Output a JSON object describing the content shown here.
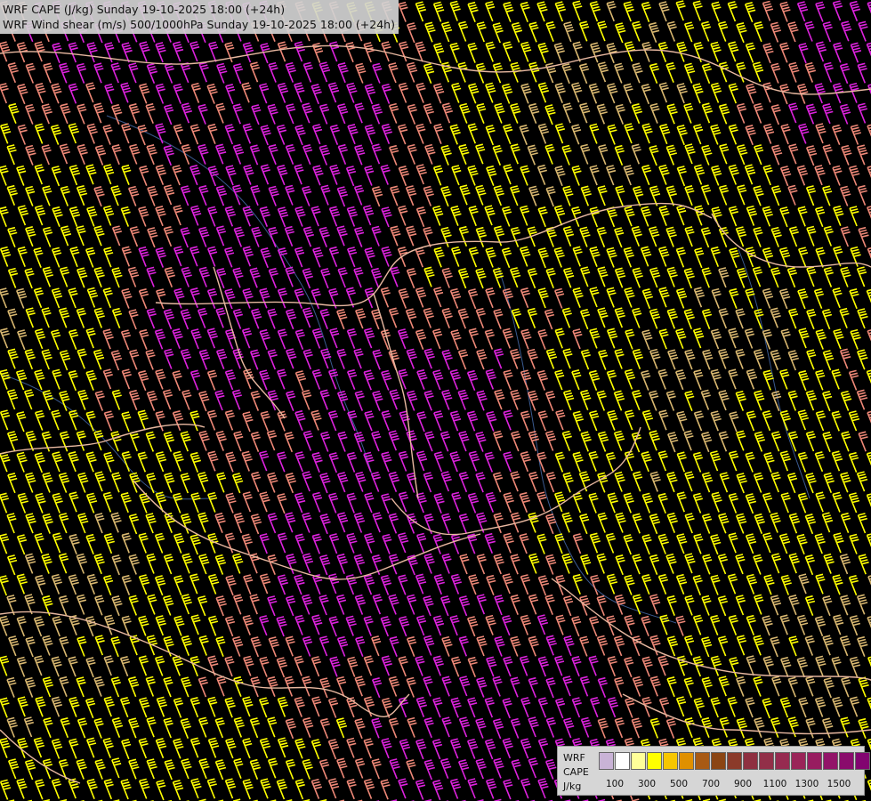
{
  "title": {
    "line1": "WRF CAPE (J/kg) Sunday 19-10-2025 18:00 (+24h)",
    "line2": "WRF Wind shear (m/s) 500/1000hPa Sunday 19-10-2025 18:00 (+24h)"
  },
  "legend": {
    "label_model": "WRF",
    "label_field": "CAPE",
    "label_unit": "J/kg",
    "swatch_colors": [
      "#c9b3d6",
      "#ffffff",
      "#ffff99",
      "#ffff00",
      "#f7c600",
      "#e09000",
      "#a85a14",
      "#8b4513",
      "#8b3a2a",
      "#8e3040",
      "#922f48",
      "#962a50",
      "#9a2458",
      "#981c60",
      "#921468",
      "#8a0c6c",
      "#820470"
    ],
    "tick_labels": [
      "100",
      "300",
      "500",
      "700",
      "900",
      "1100",
      "1300",
      "1500"
    ]
  },
  "barb_colors": {
    "magenta": "#dd22dd",
    "salmon": "#ee8877",
    "yellow": "#ffff00",
    "tan": "#d9b870"
  },
  "border_color": "#e8b8a0",
  "river_color": "#3a5a90"
}
